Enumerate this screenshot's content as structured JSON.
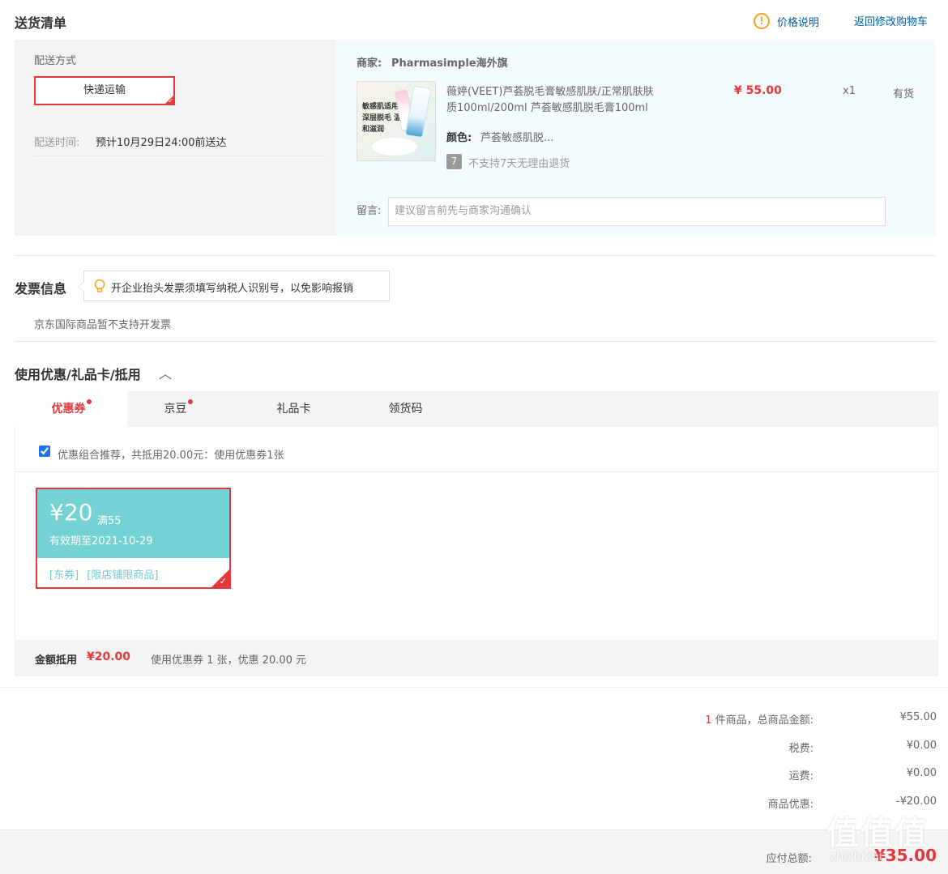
{
  "delivery": {
    "title": "送货清单",
    "price_note_icon": "exclamation-circle-icon",
    "price_note": "价格说明",
    "back_link": "返回修改购物车",
    "method_label": "配送方式",
    "method_option": "快递运输",
    "time_label": "配送时间:",
    "time_value": "预计10月29日24:00前送达"
  },
  "merchant": {
    "label": "商家:",
    "name": "Pharmasimple海外旗",
    "product": {
      "title_line1": "薇婷(VEET)芦荟脱毛膏敏感肌肤/正常肌肤肤",
      "title_line2": "质100ml/200ml 芦荟敏感肌脱毛膏100ml",
      "image_text": "敏感肌适用 深层脱毛 温和滋润",
      "price": "¥ 55.00",
      "qty": "x1",
      "stock": "有货",
      "color_label": "颜色:",
      "color_value": "芦荟敏感肌脱...",
      "return_icon": "7",
      "return_policy": "不支持7天无理由退货"
    },
    "remark_label": "留言:",
    "remark_placeholder": "建议留言前先与商家沟通确认"
  },
  "invoice": {
    "title": "发票信息",
    "tip_icon": "lightbulb-icon",
    "tip": "开企业抬头发票须填写纳税人识别号，以免影响报销",
    "note": "京东国际商品暂不支持开发票"
  },
  "discount": {
    "title": "使用优惠/礼品卡/抵用",
    "tabs": [
      {
        "label": "优惠券",
        "dot": true
      },
      {
        "label": "京豆",
        "dot": true
      },
      {
        "label": "礼品卡",
        "dot": false
      },
      {
        "label": "领货码",
        "dot": false
      }
    ],
    "combo_checked": true,
    "combo_text": "优惠组合推荐，共抵用20.00元：使用优惠券1张",
    "coupon": {
      "amount": "¥20",
      "condition": "满55",
      "validity": "有效期至2021-10-29",
      "tag1": "[东券]",
      "tag2": "[限店铺限商品]"
    },
    "summary_label": "金额抵用",
    "summary_amount": "¥20.00",
    "summary_text": "使用优惠券 1 张，优惠 20.00 元"
  },
  "totals": {
    "count": "1",
    "goods_label": "件商品，总商品金额:",
    "goods_value": "¥55.00",
    "tax_label": "税费:",
    "tax_value": "¥0.00",
    "shipping_label": "运费:",
    "shipping_value": "¥0.00",
    "discount_label": "商品优惠:",
    "discount_value": "-¥20.00",
    "payable_label": "应付总额:",
    "payable_value": "¥35.00"
  },
  "watermark": "值 什么值得买 zhizhizhi"
}
